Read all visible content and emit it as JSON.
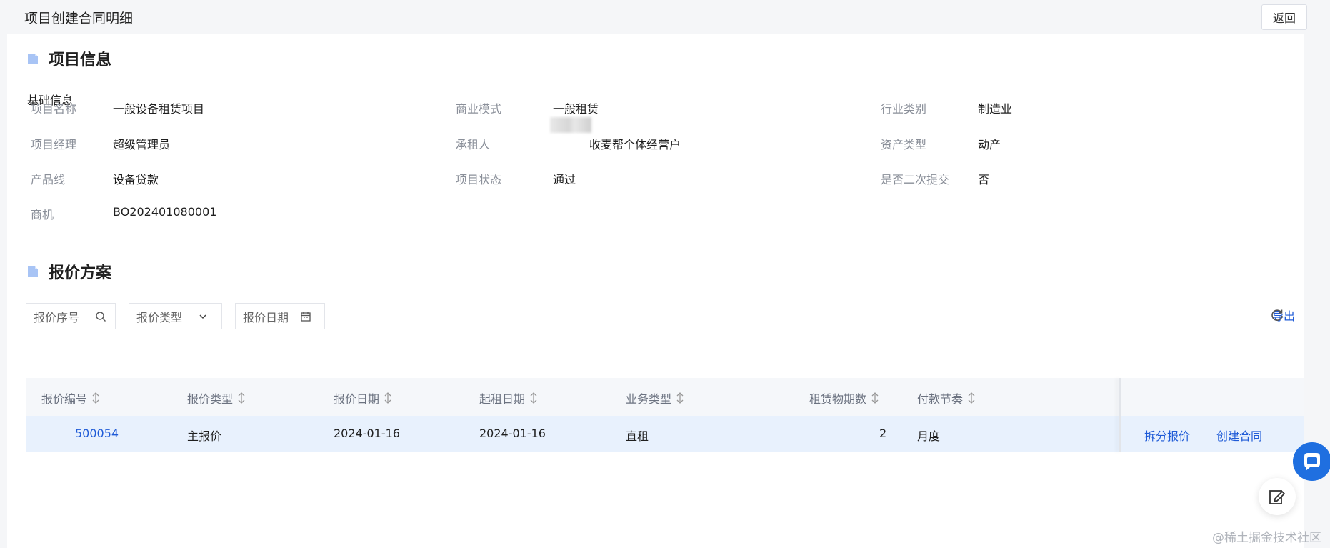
{
  "header": {
    "title": "项目创建合同明细",
    "back_label": "返回"
  },
  "project_info": {
    "section_title": "项目信息",
    "sub_title": "基础信息",
    "fields": [
      {
        "label": "项目名称",
        "value": "一般设备租赁项目"
      },
      {
        "label": "商业模式",
        "value": "一般租赁"
      },
      {
        "label": "行业类别",
        "value": "制造业"
      },
      {
        "label": "项目经理",
        "value": "超级管理员"
      },
      {
        "label": "承租人",
        "value": "收麦帮个体经营户"
      },
      {
        "label": "资产类型",
        "value": "动产"
      },
      {
        "label": "产品线",
        "value": "设备贷款"
      },
      {
        "label": "项目状态",
        "value": "通过"
      },
      {
        "label": "是否二次提交",
        "value": "否"
      },
      {
        "label": "商机",
        "value": "BO202401080001"
      }
    ]
  },
  "quote_plan": {
    "section_title": "报价方案",
    "export_label": "导出",
    "filters": {
      "quote_no_placeholder": "报价序号",
      "quote_type_placeholder": "报价类型",
      "quote_date_placeholder": "报价日期"
    },
    "columns": [
      "报价编号",
      "报价类型",
      "报价日期",
      "起租日期",
      "业务类型",
      "租赁物期数",
      "付款节奏"
    ],
    "rows": [
      {
        "quote_no": "500054",
        "quote_type": "主报价",
        "quote_date": "2024-01-16",
        "start_date": "2024-01-16",
        "business_type": "直租",
        "periods": "2",
        "payment_rhythm": "月度",
        "action_split": "拆分报价",
        "action_create": "创建合同"
      }
    ]
  },
  "watermark": "@稀土掘金技术社区",
  "colors": {
    "accent": "#1f5bd7",
    "row_highlight": "#e8f1fd",
    "header_bg": "#f5f7fa",
    "section_icon": "#a8c4f5"
  }
}
